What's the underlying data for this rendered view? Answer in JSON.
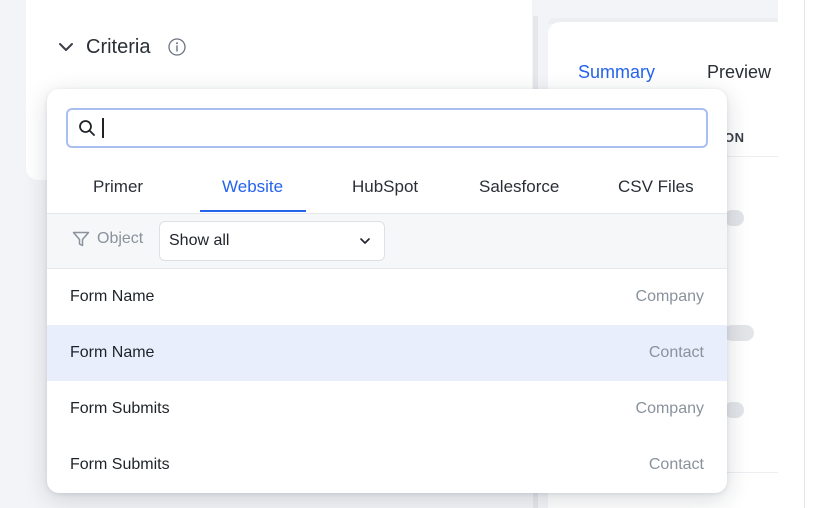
{
  "criteria": {
    "label": "Criteria"
  },
  "right_panel": {
    "tabs": [
      "Summary",
      "Preview"
    ],
    "column_header_fragment": "ON"
  },
  "search": {
    "value": "",
    "placeholder": ""
  },
  "source_tabs": [
    {
      "label": "Primer",
      "active": false
    },
    {
      "label": "Website",
      "active": true
    },
    {
      "label": "HubSpot",
      "active": false
    },
    {
      "label": "Salesforce",
      "active": false
    },
    {
      "label": "CSV Files",
      "active": false
    }
  ],
  "filter": {
    "label": "Object",
    "selected": "Show all"
  },
  "rows": [
    {
      "name": "Form Name",
      "object": "Company",
      "highlighted": false
    },
    {
      "name": "Form Name",
      "object": "Contact",
      "highlighted": true
    },
    {
      "name": "Form Submits",
      "object": "Company",
      "highlighted": false
    },
    {
      "name": "Form Submits",
      "object": "Contact",
      "highlighted": false
    }
  ],
  "colors": {
    "accent": "#2563eb",
    "highlight_row": "#e8eefb",
    "muted_text": "#8a929c",
    "search_border": "#a8bff0"
  }
}
